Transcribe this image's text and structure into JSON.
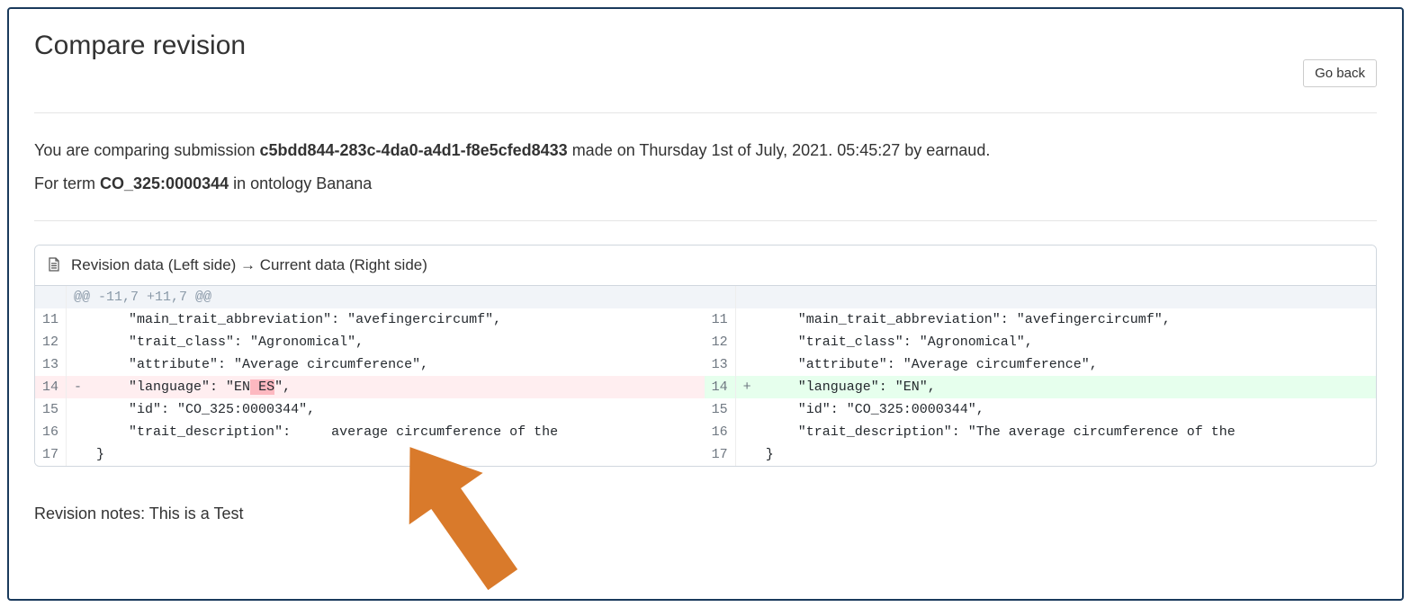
{
  "page": {
    "title": "Compare revision",
    "go_back": "Go back"
  },
  "info": {
    "prefix": "You are comparing submission ",
    "submission_id": "c5bdd844-283c-4da0-a4d1-f8e5cfed8433",
    "middle": " made on Thursday 1st of July, 2021. 05:45:27 by earnaud.",
    "term_prefix": "For term ",
    "term_id": "CO_325:0000344",
    "term_suffix": " in ontology Banana"
  },
  "diff": {
    "header": "Revision data (Left side) → Current data (Right side)",
    "hunk": "@@ -11,7 +11,7 @@",
    "rows": [
      {
        "ln_l": "11",
        "sign_l": "",
        "code_l": "    \"main_trait_abbreviation\": \"avefingercircumf\",",
        "ln_r": "11",
        "sign_r": "",
        "code_r": "    \"main_trait_abbreviation\": \"avefingercircumf\",",
        "type": "ctx"
      },
      {
        "ln_l": "12",
        "sign_l": "",
        "code_l": "    \"trait_class\": \"Agronomical\",",
        "ln_r": "12",
        "sign_r": "",
        "code_r": "    \"trait_class\": \"Agronomical\",",
        "type": "ctx"
      },
      {
        "ln_l": "13",
        "sign_l": "",
        "code_l": "    \"attribute\": \"Average circumference\",",
        "ln_r": "13",
        "sign_r": "",
        "code_r": "    \"attribute\": \"Average circumference\",",
        "type": "ctx"
      },
      {
        "ln_l": "14",
        "sign_l": "-",
        "code_l_pre": "    \"language\": \"EN",
        "code_l_del": " ES",
        "code_l_post": "\",",
        "ln_r": "14",
        "sign_r": "+",
        "code_r": "    \"language\": \"EN\",",
        "type": "chg"
      },
      {
        "ln_l": "15",
        "sign_l": "",
        "code_l": "    \"id\": \"CO_325:0000344\",",
        "ln_r": "15",
        "sign_r": "",
        "code_r": "    \"id\": \"CO_325:0000344\",",
        "type": "ctx"
      },
      {
        "ln_l": "16",
        "sign_l": "",
        "code_l": "    \"trait_description\":     average circumference of the ",
        "ln_r": "16",
        "sign_r": "",
        "code_r": "    \"trait_description\": \"The average circumference of the ",
        "type": "ctx"
      },
      {
        "ln_l": "17",
        "sign_l": "",
        "code_l": "}",
        "ln_r": "17",
        "sign_r": "",
        "code_r": "}",
        "type": "ctx"
      }
    ]
  },
  "notes": {
    "label": "Revision notes: ",
    "value": "This is a Test"
  }
}
